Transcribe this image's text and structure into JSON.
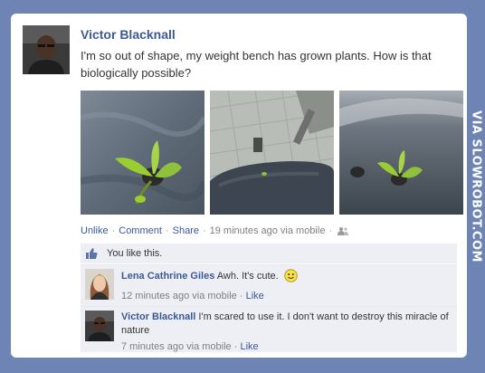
{
  "post": {
    "author": "Victor Blacknall",
    "text": "I'm so out of shape, my weight bench has grown plants. How is that biologically possible?",
    "actions": {
      "unlike": "Unlike",
      "comment": "Comment",
      "share": "Share",
      "time": "19 minutes ago via mobile"
    },
    "likes_text": "You like this."
  },
  "comments": [
    {
      "author": "Lena Cathrine Giles",
      "text": "Awh. It's cute.",
      "time": "12 minutes ago via mobile",
      "like_label": "Like"
    },
    {
      "author": "Victor Blacknall",
      "text": "I'm scared to use it. I don't want to destroy this miracle of nature",
      "time": "7 minutes ago via mobile",
      "like_label": "Like"
    }
  ],
  "watermark": "VIA SLOWROBOT.COM",
  "colors": {
    "frame": "#6d84b4",
    "link": "#3b5998",
    "comment_bg": "#edeff4"
  }
}
